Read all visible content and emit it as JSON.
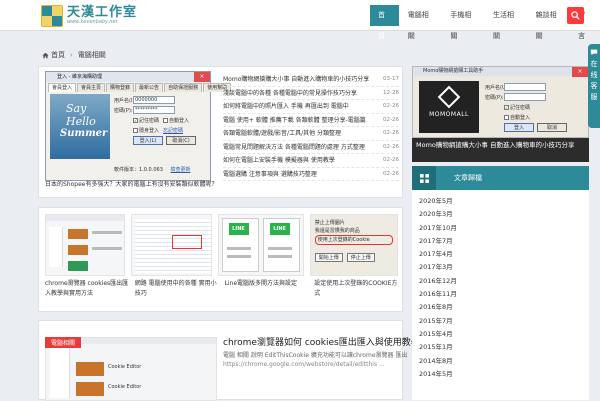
{
  "header": {
    "logo_title": "天漢工作室",
    "logo_url": "www.kevenbaby.net",
    "nav": [
      "首頁",
      "電腦相關",
      "手機相關",
      "生活相關",
      "雜談相關",
      "留言"
    ],
    "active_nav": 0
  },
  "breadcrumb": {
    "home": "首頁",
    "current": "電腦相關"
  },
  "featured": {
    "dialog_title": "登入 - 維京海購助理",
    "dialog_tabs": [
      "會員登入",
      "會員主頁",
      "購物登錄",
      "最新公告",
      "自助保證服務",
      "使用幫助"
    ],
    "img_text_1": "Say Hello",
    "img_text_2": "Summer",
    "user_label": "用戶名(I):",
    "user_value": "0000000",
    "pwd_label": "密碼(P):",
    "pwd_value": "*********",
    "chk_remember": "記住密碼",
    "chk_auto": "自動登入",
    "chk_hide": "隱身登入",
    "forgot": "忘記密碼",
    "login_btn": "登入(L)",
    "cancel_btn": "取消(C)",
    "version_label": "軟件版本：",
    "version": "1.0.0.063",
    "update_link": "檢查更新",
    "caption": "日本的Shopee有多強大？大家的電腦上有沒有安裝類似軟體呢？"
  },
  "news": [
    {
      "title": "Momo購物網搶購大小事 自動進入購物車的小技巧分享",
      "date": "03-17"
    },
    {
      "title": "淺談電腦中的各種 各種電腦中的常見操作技巧分享",
      "date": "12-28"
    },
    {
      "title": "如何將電腦中的照片匯入 手機 再匯出到 電腦中",
      "date": "02-26"
    },
    {
      "title": "電腦 使用+ 軟體 推薦下載 各類軟體 整理分享-電腦篇",
      "date": "02-26"
    },
    {
      "title": "各類電腦軟體/遊戲/影音/工具/其他 分類整理",
      "date": "02-26"
    },
    {
      "title": "電腦常見問題解決方法 各種電腦問題的處理 方式整理",
      "date": "02-26"
    },
    {
      "title": "如何在電腦上安裝手機 模擬器與 使用教學",
      "date": "02-26"
    },
    {
      "title": "電腦選購 注意事項與 選購技巧整理",
      "date": "02-26"
    }
  ],
  "thumbs": [
    {
      "caption": "chrome瀏覽器 cookies匯出匯入教學與實用方法"
    },
    {
      "caption": "網路 電腦使用中的各種 實用小技巧"
    },
    {
      "caption": "Line電腦版多開方法與設定"
    },
    {
      "caption": "設定使用上次登錄的COOKIE方式"
    }
  ],
  "thumb3_label": "LINE",
  "thumb4_items": [
    "禁止上傳圖片",
    "我還是習慣我的商品",
    "使用上次登錄的Cookie"
  ],
  "thumb4_btns": [
    "開始上傳",
    "停止上傳"
  ],
  "article": {
    "tag": "電腦相關",
    "title": "chrome瀏覽器如何 cookies匯出匯入與使用教學",
    "meta": "電腦 相關 說明 EditThisCookie 擴充功能可以讓chrome瀏覽器 匯出",
    "body": "https://chrome.google.com/webstore/detail/editthis ...",
    "ext_label": "Cookie Editor",
    "ext_label_2": "Cookie Editor"
  },
  "sidebar": {
    "shot_title": "Momo購物網搶購工具助手",
    "shot_brand": "MOMOMALL",
    "shot_user": "用戶名(U):",
    "shot_pwd": "密碼(P):",
    "shot_remember": "記住密碼",
    "shot_auto": "自動登入",
    "shot_login": "登入",
    "shot_cancel": "取消",
    "caption": "Momo購物網搶購大小事 自動進入購物車的小技巧分享",
    "archive_title": "文章歸檔",
    "archive": [
      "2020年5月",
      "2020年3月",
      "2017年10月",
      "2017年7月",
      "2017年4月",
      "2017年3月",
      "2016年12月",
      "2016年11月",
      "2016年8月",
      "2015年7月",
      "2015年4月",
      "2015年1月",
      "2014年8月",
      "2014年5月"
    ]
  },
  "float": {
    "chars": [
      "在",
      "线",
      "客",
      "服"
    ]
  },
  "colors": {
    "accent": "#2c8a99",
    "danger": "#e83a3a"
  }
}
